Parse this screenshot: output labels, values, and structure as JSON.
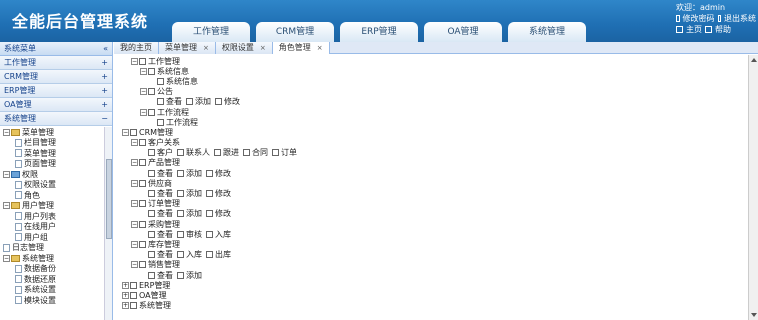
{
  "header": {
    "title": "全能后台管理系统",
    "tabs": [
      "工作管理",
      "CRM管理",
      "ERP管理",
      "OA管理",
      "系统管理"
    ],
    "user": {
      "line1": "欢迎：admin",
      "line2a": "修改密码",
      "line2b": "退出系统",
      "line3a": "主页",
      "line3b": "帮助"
    }
  },
  "sidebar": {
    "title": "系统菜单",
    "collapse": "«",
    "panels": [
      "工作管理",
      "CRM管理",
      "ERP管理",
      "OA管理",
      "系统管理"
    ],
    "panel_marks": [
      "+",
      "+",
      "+",
      "+",
      "−"
    ],
    "tree": [
      {
        "level": 0,
        "type": "folder",
        "exp": "−",
        "label": "菜单管理"
      },
      {
        "level": 1,
        "type": "page",
        "label": "栏目管理"
      },
      {
        "level": 1,
        "type": "page",
        "label": "菜单管理"
      },
      {
        "level": 1,
        "type": "page",
        "label": "页面管理"
      },
      {
        "level": 0,
        "type": "folder-blue",
        "exp": "−",
        "label": "权限"
      },
      {
        "level": 1,
        "type": "page",
        "label": "权限设置"
      },
      {
        "level": 1,
        "type": "page",
        "label": "角色"
      },
      {
        "level": 0,
        "type": "folder",
        "exp": "−",
        "label": "用户管理"
      },
      {
        "level": 1,
        "type": "page",
        "label": "用户列表"
      },
      {
        "level": 1,
        "type": "page",
        "label": "在线用户"
      },
      {
        "level": 1,
        "type": "page",
        "label": "用户组"
      },
      {
        "level": 0,
        "type": "page",
        "exp": "",
        "label": "日志管理"
      },
      {
        "level": 0,
        "type": "folder",
        "exp": "−",
        "label": "系统管理"
      },
      {
        "level": 1,
        "type": "page",
        "label": "数据备份"
      },
      {
        "level": 1,
        "type": "page",
        "label": "数据还原"
      },
      {
        "level": 1,
        "type": "page",
        "label": "系统设置"
      },
      {
        "level": 1,
        "type": "page",
        "label": "模块设置"
      }
    ]
  },
  "content_tabs": [
    {
      "label": "我的主页",
      "close": ""
    },
    {
      "label": "菜单管理",
      "close": "×"
    },
    {
      "label": "权限设置",
      "close": "×"
    },
    {
      "label": "角色管理",
      "close": "×"
    }
  ],
  "main_tree": [
    {
      "indent": 1,
      "exp": "−",
      "items": [
        "工作管理"
      ]
    },
    {
      "indent": 2,
      "exp": "−",
      "items": [
        "系统信息"
      ]
    },
    {
      "indent": 3,
      "exp": "",
      "items": [
        "系统信息"
      ]
    },
    {
      "indent": 2,
      "exp": "−",
      "items": [
        "公告"
      ]
    },
    {
      "indent": 3,
      "exp": "",
      "items": [
        "查看",
        "添加",
        "修改"
      ]
    },
    {
      "indent": 2,
      "exp": "−",
      "items": [
        "工作流程"
      ]
    },
    {
      "indent": 3,
      "exp": "",
      "items": [
        "工作流程"
      ]
    },
    {
      "indent": 0,
      "exp": "−",
      "items": [
        "CRM管理"
      ]
    },
    {
      "indent": 1,
      "exp": "−",
      "items": [
        "客户关系"
      ]
    },
    {
      "indent": 2,
      "exp": "",
      "items": [
        "客户",
        "联系人",
        "跟进",
        "合同",
        "订单"
      ]
    },
    {
      "indent": 1,
      "exp": "−",
      "items": [
        "产品管理"
      ]
    },
    {
      "indent": 2,
      "exp": "",
      "items": [
        "查看",
        "添加",
        "修改"
      ]
    },
    {
      "indent": 1,
      "exp": "−",
      "items": [
        "供应商"
      ]
    },
    {
      "indent": 2,
      "exp": "",
      "items": [
        "查看",
        "添加",
        "修改"
      ]
    },
    {
      "indent": 1,
      "exp": "−",
      "items": [
        "订单管理"
      ]
    },
    {
      "indent": 2,
      "exp": "",
      "items": [
        "查看",
        "添加",
        "修改"
      ]
    },
    {
      "indent": 1,
      "exp": "−",
      "items": [
        "采购管理"
      ]
    },
    {
      "indent": 2,
      "exp": "",
      "items": [
        "查看",
        "审核",
        "入库"
      ]
    },
    {
      "indent": 1,
      "exp": "−",
      "items": [
        "库存管理"
      ]
    },
    {
      "indent": 2,
      "exp": "",
      "items": [
        "查看",
        "入库",
        "出库"
      ]
    },
    {
      "indent": 1,
      "exp": "−",
      "items": [
        "销售管理"
      ]
    },
    {
      "indent": 2,
      "exp": "",
      "items": [
        "查看",
        "添加"
      ]
    },
    {
      "indent": 0,
      "exp": "+",
      "items": [
        "ERP管理"
      ]
    },
    {
      "indent": 0,
      "exp": "+",
      "items": [
        "OA管理"
      ]
    },
    {
      "indent": 0,
      "exp": "+",
      "items": [
        "系统管理"
      ]
    }
  ]
}
